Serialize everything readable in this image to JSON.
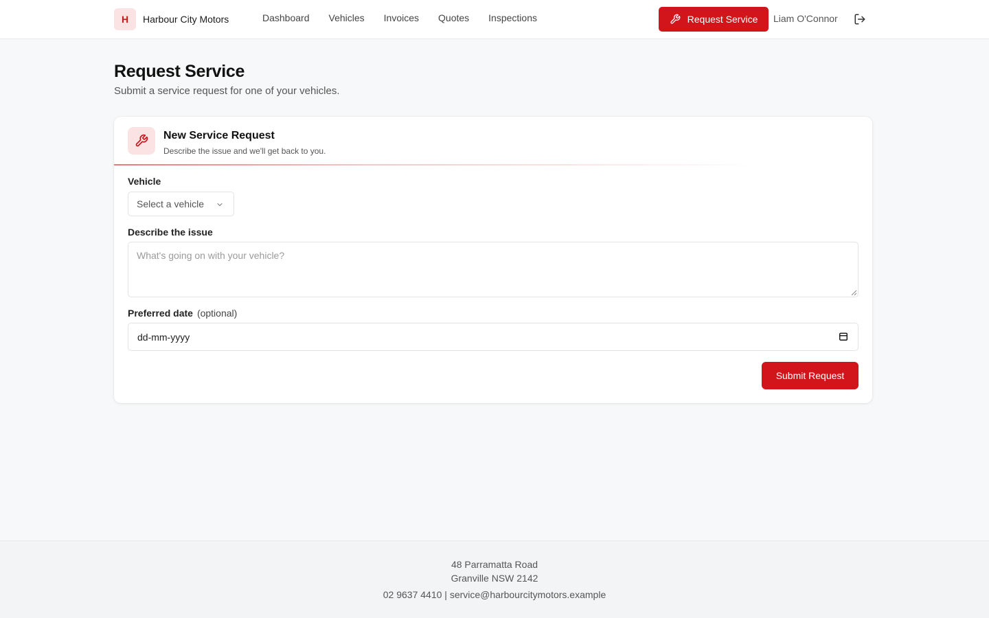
{
  "header": {
    "brand_letter": "H",
    "brand_name": "Harbour City Motors",
    "nav": [
      "Dashboard",
      "Vehicles",
      "Invoices",
      "Quotes",
      "Inspections"
    ],
    "request_button": "Request Service",
    "user_name": "Liam O'Connor"
  },
  "page": {
    "title": "Request Service",
    "subtitle": "Submit a service request for one of your vehicles."
  },
  "form": {
    "title": "New Service Request",
    "description": "Describe the issue and we'll get back to you.",
    "vehicle_label": "Vehicle",
    "vehicle_value": "Select a vehicle",
    "issue_label": "Describe the issue",
    "issue_placeholder": "What's going on with your vehicle?",
    "date_label": "Preferred date",
    "date_optional": "(optional)",
    "date_value": "dd-mm-yyyy",
    "submit_label": "Submit Request"
  },
  "footer": {
    "address_line1": "48 Parramatta Road",
    "address_line2": "Granville NSW 2142",
    "contact": "02 9637 4410 | service@harbourcitymotors.example"
  },
  "colors": {
    "accent": "#d1151b",
    "accent_soft": "#fbe3e3",
    "background": "#f7f8f9"
  },
  "icons": {
    "request_button": "wrench-icon",
    "form_header": "wrench-icon",
    "logout": "logout-icon",
    "select": "chevron-down-icon",
    "date": "calendar-icon"
  }
}
